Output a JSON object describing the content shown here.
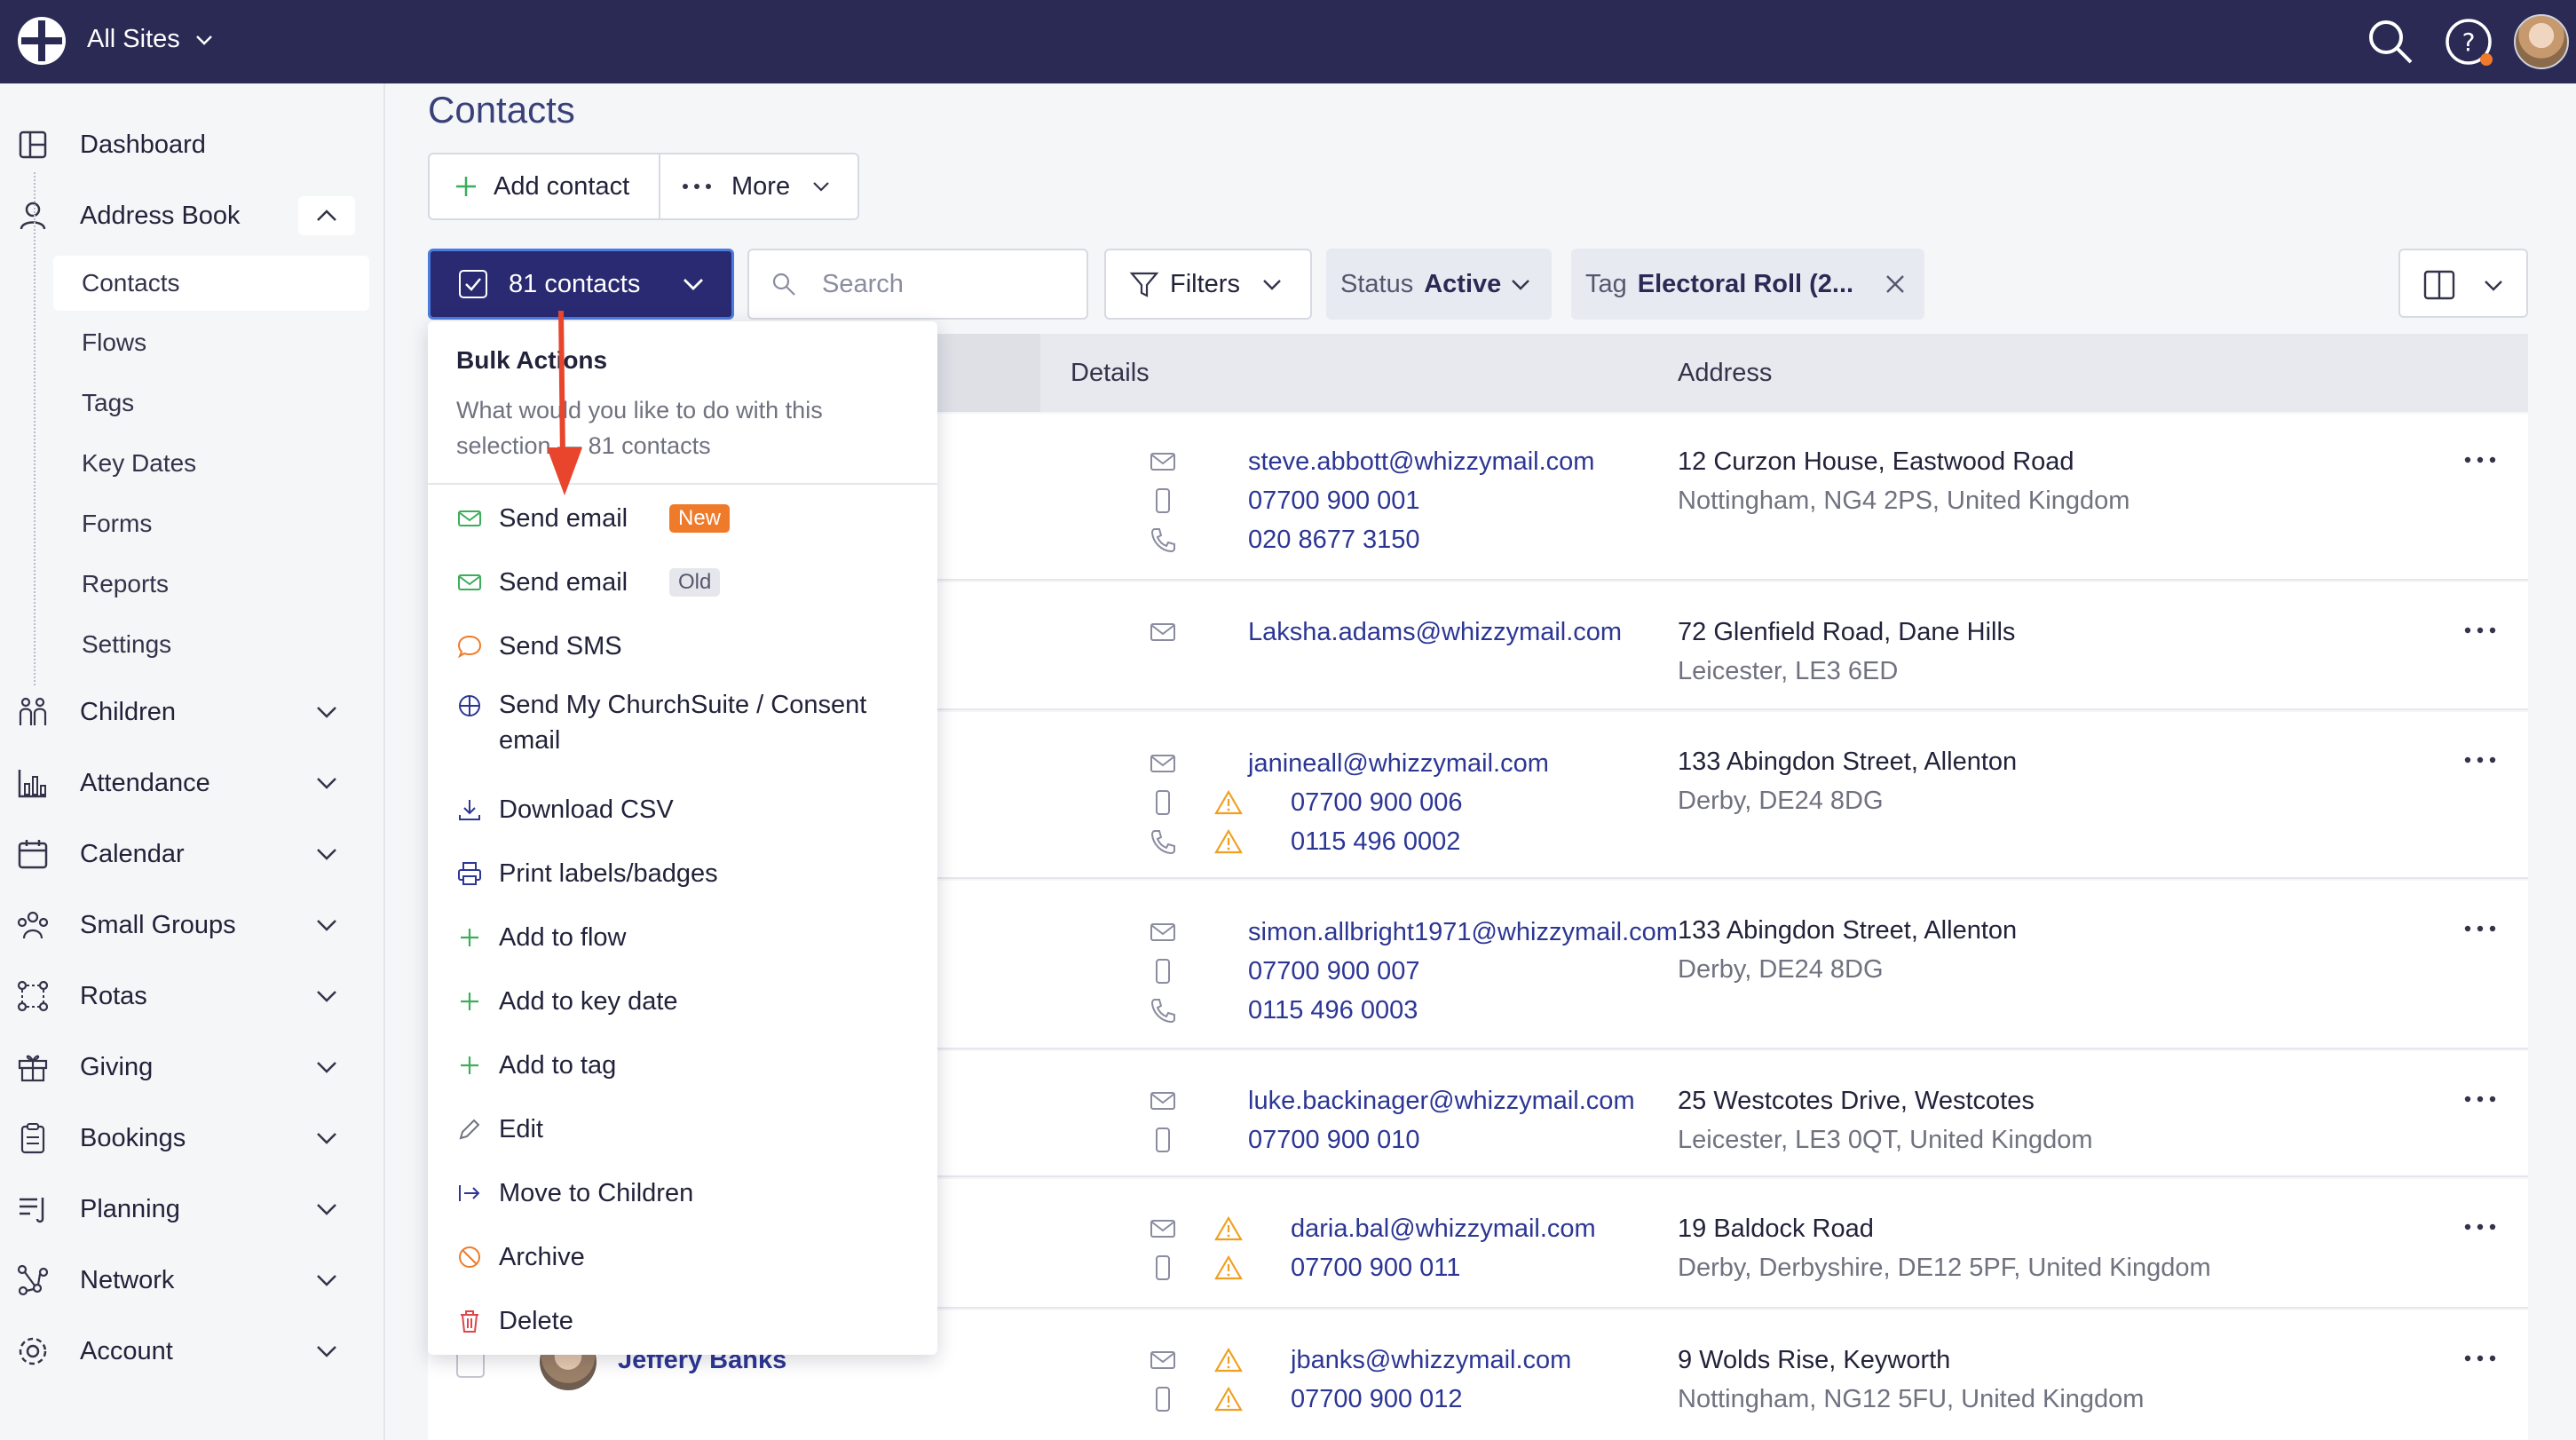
{
  "topbar": {
    "site_selector": "All Sites"
  },
  "page": {
    "title": "Contacts"
  },
  "toolbar": {
    "add_contact": "Add contact",
    "more": "More"
  },
  "filterbar": {
    "bulk_label": "81 contacts",
    "search_placeholder": "Search",
    "filters": "Filters",
    "status_key": "Status",
    "status_value": "Active",
    "tag_key": "Tag",
    "tag_value": "Electoral Roll (2..."
  },
  "sidebar": {
    "dashboard": "Dashboard",
    "address_book": "Address Book",
    "sub": [
      "Contacts",
      "Flows",
      "Tags",
      "Key Dates",
      "Forms",
      "Reports",
      "Settings"
    ],
    "children": "Children",
    "attendance": "Attendance",
    "calendar": "Calendar",
    "small_groups": "Small Groups",
    "rotas": "Rotas",
    "giving": "Giving",
    "bookings": "Bookings",
    "planning": "Planning",
    "network": "Network",
    "account": "Account"
  },
  "table": {
    "col_details": "Details",
    "col_address": "Address"
  },
  "rows": [
    {
      "email": "steve.abbott@whizzymail.com",
      "mobile": "07700 900 001",
      "phone": "020 8677 3150",
      "addr1": "12 Curzon House, Eastwood Road",
      "addr2": "Nottingham, NG4 2PS, United Kingdom"
    },
    {
      "email": "Laksha.adams@whizzymail.com",
      "addr1": "72 Glenfield Road, Dane Hills",
      "addr2": "Leicester, LE3 6ED"
    },
    {
      "email": "janineall@whizzymail.com",
      "mobile": "07700 900 006",
      "phone": "0115 496 0002",
      "addr1": "133 Abingdon Street, Allenton",
      "addr2": "Derby, DE24 8DG"
    },
    {
      "email": "simon.allbright1971@whizzymail.com",
      "mobile": "07700 900 007",
      "phone": "0115 496 0003",
      "addr1": "133 Abingdon Street, Allenton",
      "addr2": "Derby, DE24 8DG"
    },
    {
      "email": "luke.backinager@whizzymail.com",
      "mobile": "07700 900 010",
      "addr1": "25 Westcotes Drive, Westcotes",
      "addr2": "Leicester, LE3 0QT, United Kingdom"
    },
    {
      "email": "daria.bal@whizzymail.com",
      "mobile": "07700 900 011",
      "addr1": "19 Baldock Road",
      "addr2": "Derby, Derbyshire, DE12 5PF, United Kingdom"
    },
    {
      "name": "Jeffery Banks",
      "email": "jbanks@whizzymail.com",
      "mobile": "07700 900 012",
      "addr1": "9 Wolds Rise, Keyworth",
      "addr2": "Nottingham, NG12 5FU, United Kingdom"
    }
  ],
  "bulk": {
    "title": "Bulk Actions",
    "desc": "What would you like to do with this selection — 81 contacts",
    "items": {
      "send_email_new": "Send email",
      "badge_new": "New",
      "send_email_old": "Send email",
      "badge_old": "Old",
      "send_sms": "Send SMS",
      "send_mcs_1": "Send My ChurchSuite / Consent",
      "send_mcs_2": "email",
      "download_csv": "Download CSV",
      "print_labels": "Print labels/badges",
      "add_flow": "Add to flow",
      "add_key_date": "Add to key date",
      "add_tag": "Add to tag",
      "edit": "Edit",
      "move_children": "Move to Children",
      "archive": "Archive",
      "delete": "Delete"
    }
  },
  "colors": {
    "topbar": "#2a2a55",
    "accent": "#2c3694",
    "new_badge": "#ef7a2a",
    "arrow": "#e8452c",
    "warning": "#f0a020",
    "delete": "#e0454a"
  }
}
